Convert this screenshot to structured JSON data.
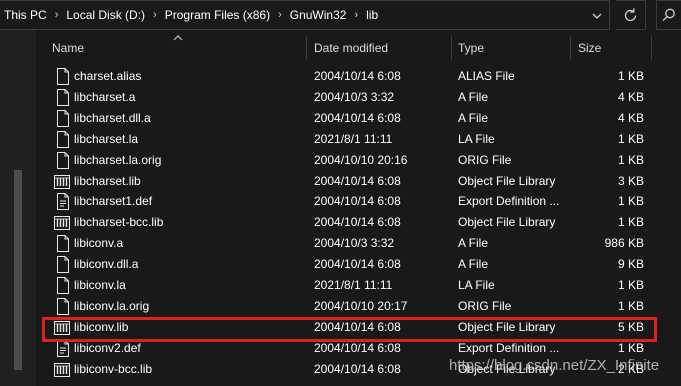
{
  "breadcrumb": [
    "This PC",
    "Local Disk (D:)",
    "Program Files (x86)",
    "GnuWin32",
    "lib"
  ],
  "columns": {
    "name": "Name",
    "date": "Date modified",
    "type": "Type",
    "size": "Size"
  },
  "files": [
    {
      "icon": "file-icon",
      "name": "charset.alias",
      "date": "2004/10/14 6:08",
      "type": "ALIAS File",
      "size": "1 KB"
    },
    {
      "icon": "file-icon",
      "name": "libcharset.a",
      "date": "2004/10/3 3:32",
      "type": "A File",
      "size": "4 KB"
    },
    {
      "icon": "file-icon",
      "name": "libcharset.dll.a",
      "date": "2004/10/14 6:08",
      "type": "A File",
      "size": "4 KB"
    },
    {
      "icon": "file-icon",
      "name": "libcharset.la",
      "date": "2021/8/1 11:11",
      "type": "LA File",
      "size": "1 KB"
    },
    {
      "icon": "file-icon",
      "name": "libcharset.la.orig",
      "date": "2004/10/10 20:16",
      "type": "ORIG File",
      "size": "1 KB"
    },
    {
      "icon": "library-icon",
      "name": "libcharset.lib",
      "date": "2004/10/14 6:08",
      "type": "Object File Library",
      "size": "3 KB"
    },
    {
      "icon": "document-icon",
      "name": "libcharset1.def",
      "date": "2004/10/14 6:08",
      "type": "Export Definition ...",
      "size": "1 KB"
    },
    {
      "icon": "library-icon",
      "name": "libcharset-bcc.lib",
      "date": "2004/10/14 6:08",
      "type": "Object File Library",
      "size": "1 KB"
    },
    {
      "icon": "file-icon",
      "name": "libiconv.a",
      "date": "2004/10/3 3:32",
      "type": "A File",
      "size": "986 KB"
    },
    {
      "icon": "file-icon",
      "name": "libiconv.dll.a",
      "date": "2004/10/14 6:08",
      "type": "A File",
      "size": "9 KB"
    },
    {
      "icon": "file-icon",
      "name": "libiconv.la",
      "date": "2021/8/1 11:11",
      "type": "LA File",
      "size": "1 KB"
    },
    {
      "icon": "file-icon",
      "name": "libiconv.la.orig",
      "date": "2004/10/10 20:17",
      "type": "ORIG File",
      "size": "1 KB"
    },
    {
      "icon": "library-icon",
      "name": "libiconv.lib",
      "date": "2004/10/14 6:08",
      "type": "Object File Library",
      "size": "5 KB"
    },
    {
      "icon": "document-icon",
      "name": "libiconv2.def",
      "date": "2004/10/14 6:08",
      "type": "Export Definition ...",
      "size": "1 KB"
    },
    {
      "icon": "library-icon",
      "name": "libiconv-bcc.lib",
      "date": "2004/10/14 6:08",
      "type": "Object File Library",
      "size": "2 KB"
    }
  ],
  "highlighted_file": "libiconv.lib",
  "watermark": "https://blog.csdn.net/ZX_Infinite",
  "colors": {
    "background": "#191919",
    "highlight_border": "#e0201e",
    "text": "#ffffff"
  }
}
